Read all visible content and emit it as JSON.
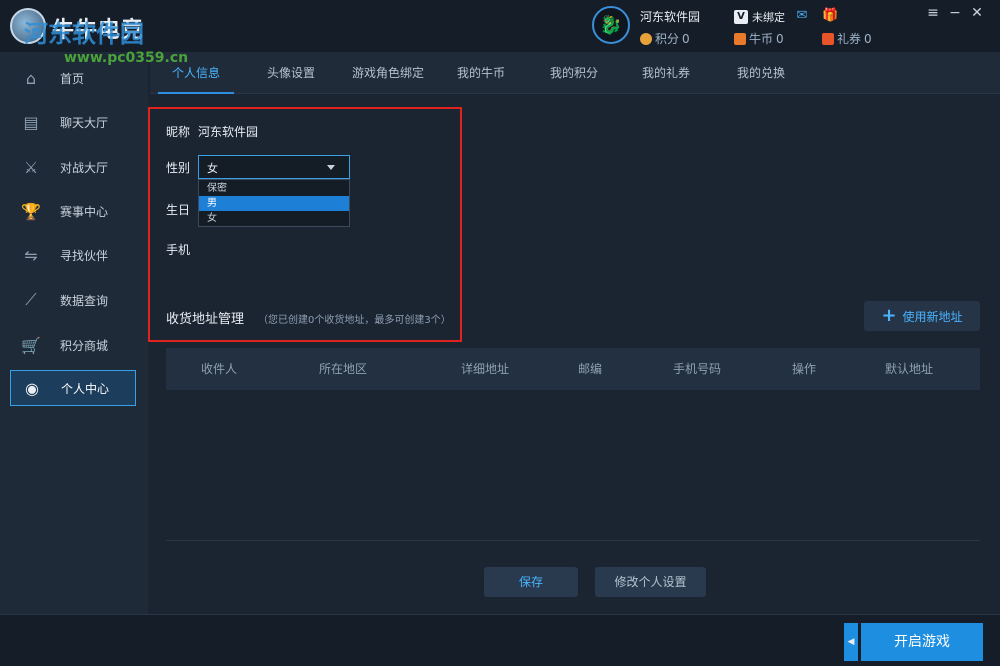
{
  "app": {
    "logo_text": "牛牛电竞",
    "watermark": "河东软件园",
    "watermark_url": "www.pc0359.cn"
  },
  "header": {
    "user_name": "河东软件园",
    "points_label": "积分",
    "points_value": "0",
    "coins_label": "牛币",
    "coins_value": "0",
    "vouchers_label": "礼券",
    "vouchers_value": "0",
    "bind_status": "未绑定"
  },
  "sidebar": {
    "items": [
      {
        "label": "首页",
        "icon": "home-icon"
      },
      {
        "label": "聊天大厅",
        "icon": "chat-icon"
      },
      {
        "label": "对战大厅",
        "icon": "swords-icon"
      },
      {
        "label": "赛事中心",
        "icon": "trophy-icon"
      },
      {
        "label": "寻找伙伴",
        "icon": "handshake-icon"
      },
      {
        "label": "数据查询",
        "icon": "chart-icon"
      },
      {
        "label": "积分商城",
        "icon": "cart-icon"
      },
      {
        "label": "个人中心",
        "icon": "user-icon"
      }
    ],
    "active_index": 7
  },
  "tabs": [
    "个人信息",
    "头像设置",
    "游戏角色绑定",
    "我的牛币",
    "我的积分",
    "我的礼券",
    "我的兑换"
  ],
  "form": {
    "nickname_label": "昵称",
    "nickname_value": "河东软件园",
    "gender_label": "性别",
    "gender_value": "女",
    "gender_options": [
      "保密",
      "男",
      "女"
    ],
    "gender_highlighted": "男",
    "birthday_label": "生日",
    "phone_label": "手机"
  },
  "address": {
    "title": "收货地址管理",
    "note": "（您已创建0个收货地址，最多可创建3个）",
    "new_button": "使用新地址",
    "columns": [
      "收件人",
      "所在地区",
      "详细地址",
      "邮编",
      "手机号码",
      "操作",
      "默认地址"
    ]
  },
  "actions": {
    "save": "保存",
    "modify": "修改个人设置",
    "start_game": "开启游戏"
  },
  "colors": {
    "accent": "#1e8fe0",
    "highlight_box": "#e0231e",
    "background": "#1b2431"
  }
}
